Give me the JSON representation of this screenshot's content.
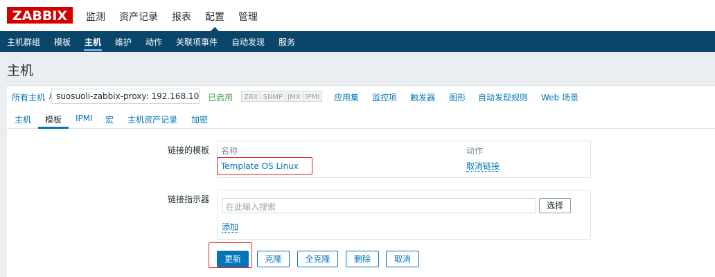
{
  "header": {
    "logo": "ZABBIX",
    "menu": [
      "监测",
      "资产记录",
      "报表",
      "配置",
      "管理"
    ]
  },
  "subnav": {
    "items": [
      "主机群组",
      "模板",
      "主机",
      "维护",
      "动作",
      "关联项事件",
      "自动发现",
      "服务"
    ],
    "selected": "主机"
  },
  "page": {
    "title": "主机"
  },
  "breadcrumb": {
    "all_hosts": "所有主机",
    "separator": "/",
    "host_name": "suosuoli-zabbix-proxy: 192.168.10...",
    "status": "已启用",
    "availability": [
      "ZBX",
      "SNMP",
      "JMX",
      "IPMI"
    ],
    "links": [
      "应用集",
      "监控项",
      "触发器",
      "图形",
      "自动发现规则",
      "Web 场景"
    ]
  },
  "tabs": {
    "items": [
      "主机",
      "模板",
      "IPMI",
      "宏",
      "主机资产记录",
      "加密"
    ],
    "active": "模板"
  },
  "form": {
    "linked_templates_label": "链接的模板",
    "linked_templates": {
      "col_name": "名称",
      "col_action": "动作",
      "rows": [
        {
          "name": "Template OS Linux",
          "action": "取消链接"
        }
      ]
    },
    "link_indicator_label": "链接指示器",
    "search_placeholder": "在此输入搜索",
    "select_button": "选择",
    "add_link": "添加"
  },
  "buttons": {
    "update": "更新",
    "clone": "克隆",
    "full_clone": "全克隆",
    "delete": "删除",
    "cancel": "取消"
  },
  "colors": {
    "brand_red": "#d40000",
    "nav_dark": "#0a466a",
    "link_blue": "#0275b8",
    "enabled_green": "#429e47",
    "highlight_red": "#e02020"
  }
}
